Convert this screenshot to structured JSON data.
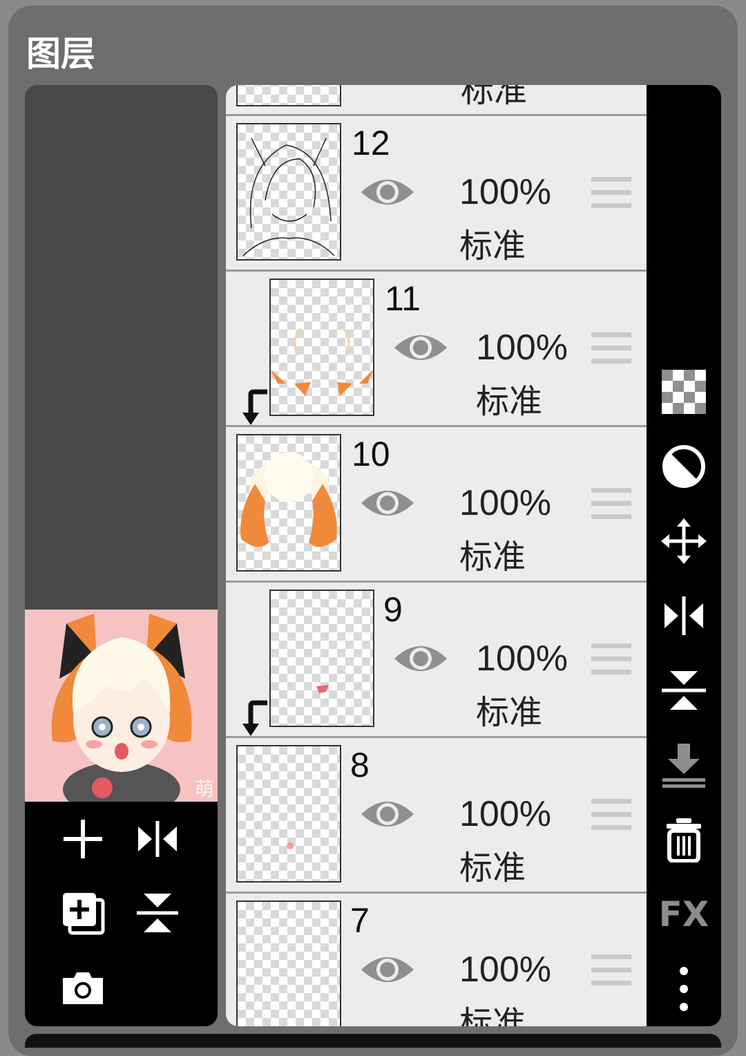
{
  "panel": {
    "title": "图层"
  },
  "layers": [
    {
      "number": "",
      "opacity": "",
      "mode": "标准"
    },
    {
      "number": "12",
      "opacity": "100%",
      "mode": "标准"
    },
    {
      "number": "11",
      "opacity": "100%",
      "mode": "标准"
    },
    {
      "number": "10",
      "opacity": "100%",
      "mode": "标准"
    },
    {
      "number": "9",
      "opacity": "100%",
      "mode": "标准"
    },
    {
      "number": "8",
      "opacity": "100%",
      "mode": "标准"
    },
    {
      "number": "7",
      "opacity": "100%",
      "mode": "标准"
    }
  ],
  "preview": {
    "signature": "萌"
  },
  "left_tools": [
    "add-layer-icon",
    "flip-horizontal-icon",
    "duplicate-layer-icon",
    "flip-vertical-icon",
    "camera-icon"
  ],
  "right_tools": [
    "transparency-icon",
    "opacity-icon",
    "move-icon",
    "flip-horizontal-icon",
    "flip-vertical-icon",
    "merge-down-icon",
    "trash-icon",
    "fx-icon",
    "more-icon"
  ],
  "right_fx_label": "FX",
  "colors": {
    "panel": "#6e6e6e",
    "row": "#ecebee",
    "accent_orange": "#f0893a",
    "preview_bg": "#f6c2c2"
  }
}
